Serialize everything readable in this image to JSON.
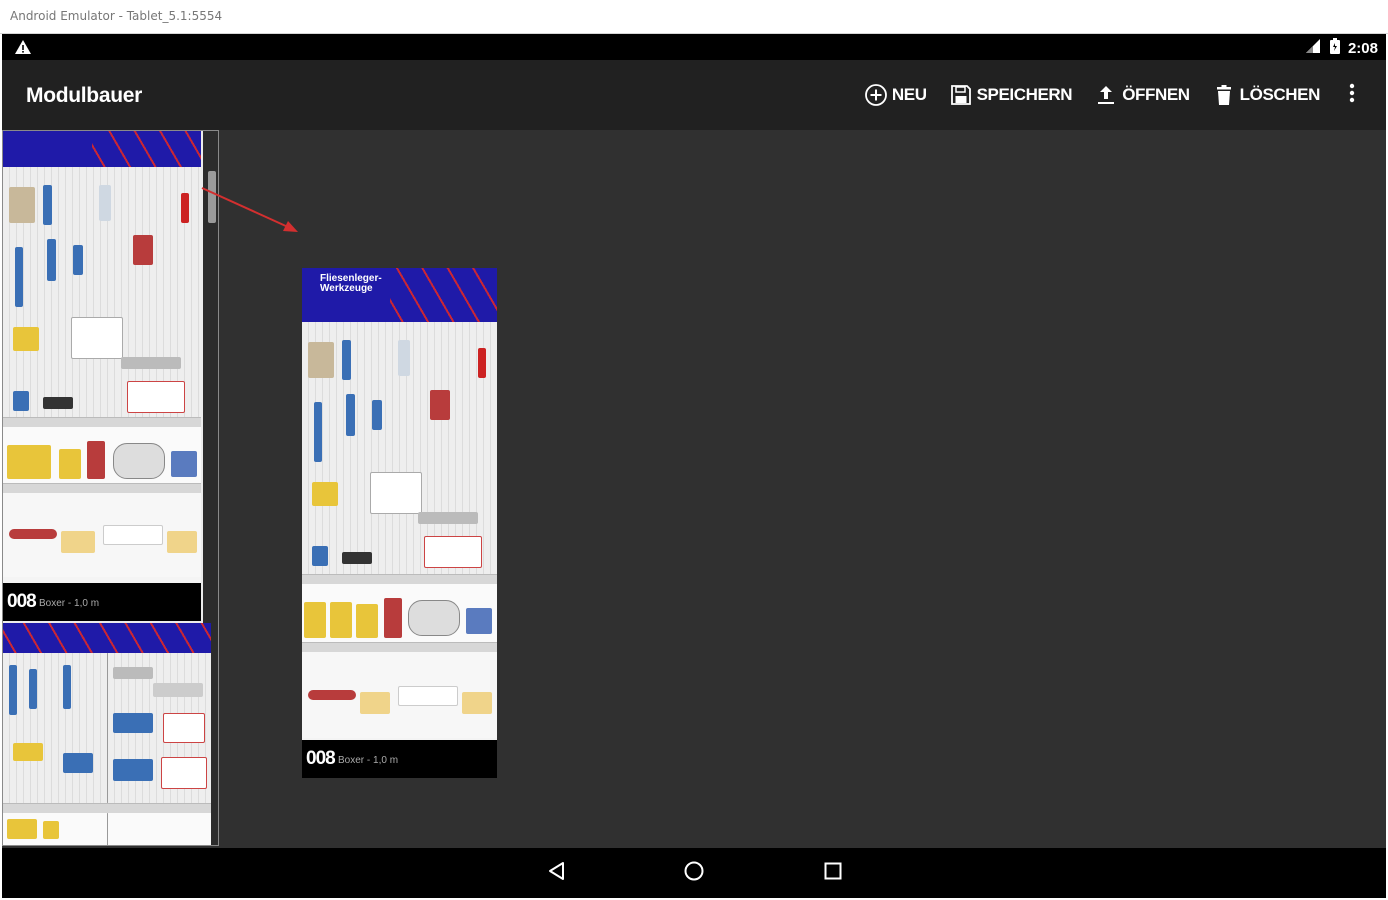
{
  "window": {
    "title": "Android Emulator - Tablet_5.1:5554"
  },
  "status_bar": {
    "time": "2:08"
  },
  "app_bar": {
    "title": "Modulbauer",
    "actions": [
      {
        "label": "NEU",
        "icon": "add-circle-icon"
      },
      {
        "label": "SPEICHERN",
        "icon": "save-icon"
      },
      {
        "label": "ÖFFNEN",
        "icon": "upload-icon"
      },
      {
        "label": "LÖSCHEN",
        "icon": "trash-icon"
      }
    ],
    "overflow_icon": "more-vert-icon"
  },
  "sidebar": {
    "modules": [
      {
        "number": "008",
        "subtitle": "Boxer - 1,0 m"
      },
      {
        "number": "",
        "subtitle": ""
      }
    ]
  },
  "canvas": {
    "placed_module": {
      "number": "008",
      "subtitle": "Boxer - 1,0 m",
      "header_text": "Fliesenleger- Werkzeuge"
    }
  },
  "nav_bar": {
    "buttons": [
      "back-icon",
      "home-icon",
      "recents-icon"
    ]
  },
  "colors": {
    "app_bar": "#212121",
    "canvas": "#303030",
    "module_header": "#1f1aa8",
    "arrow": "#d32f2f"
  }
}
